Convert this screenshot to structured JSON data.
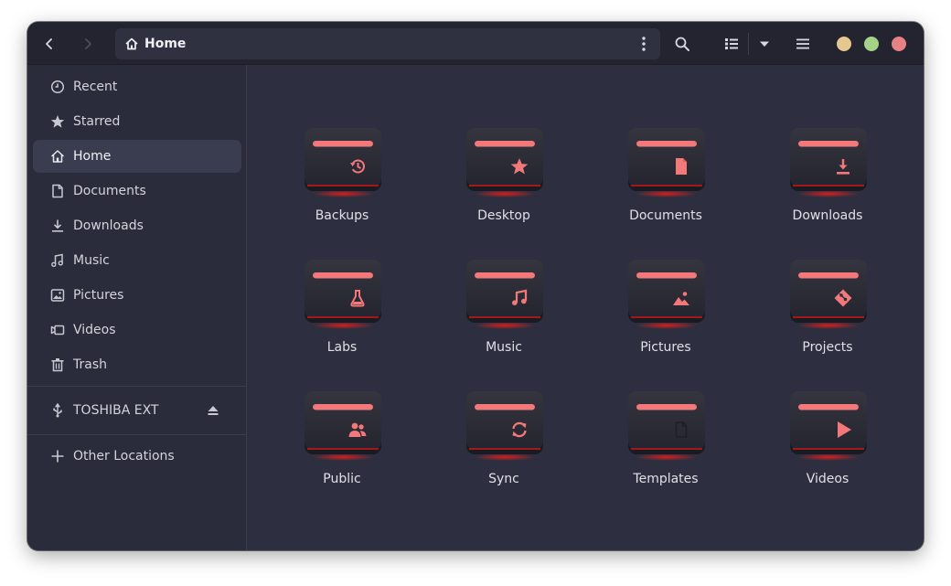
{
  "header": {
    "back_icon": "chevron-left-icon",
    "forward_icon": "chevron-right-icon",
    "path": {
      "icon": "home-icon",
      "label": "Home"
    },
    "path_menu_icon": "vertical-dots-icon",
    "search_icon": "search-icon",
    "view_icon": "list-view-icon",
    "view_dropdown_icon": "caret-down-icon",
    "menu_icon": "hamburger-icon",
    "window_controls": {
      "minimize": "#e5c890",
      "maximize": "#a6d189",
      "close": "#e78284"
    }
  },
  "sidebar": {
    "items": [
      {
        "label": "Recent",
        "icon": "clock-icon"
      },
      {
        "label": "Starred",
        "icon": "star-icon"
      },
      {
        "label": "Home",
        "icon": "home-icon",
        "active": true
      },
      {
        "label": "Documents",
        "icon": "document-icon"
      },
      {
        "label": "Downloads",
        "icon": "download-icon"
      },
      {
        "label": "Music",
        "icon": "music-icon"
      },
      {
        "label": "Pictures",
        "icon": "picture-icon"
      },
      {
        "label": "Videos",
        "icon": "video-camera-icon"
      },
      {
        "label": "Trash",
        "icon": "trash-icon"
      }
    ],
    "devices": [
      {
        "label": "TOSHIBA EXT",
        "icon": "usb-icon",
        "action_icon": "eject-icon"
      }
    ],
    "other": {
      "label": "Other Locations",
      "icon": "plus-icon"
    }
  },
  "folders": [
    {
      "label": "Backups",
      "icon": "history-icon"
    },
    {
      "label": "Desktop",
      "icon": "star-icon"
    },
    {
      "label": "Documents",
      "icon": "document-icon"
    },
    {
      "label": "Downloads",
      "icon": "download-icon"
    },
    {
      "label": "Labs",
      "icon": "flask-icon"
    },
    {
      "label": "Music",
      "icon": "music-icon"
    },
    {
      "label": "Pictures",
      "icon": "picture-icon"
    },
    {
      "label": "Projects",
      "icon": "git-icon"
    },
    {
      "label": "Public",
      "icon": "people-icon"
    },
    {
      "label": "Sync",
      "icon": "sync-icon"
    },
    {
      "label": "Templates",
      "icon": "template-icon"
    },
    {
      "label": "Videos",
      "icon": "play-icon"
    }
  ],
  "colors": {
    "accent": "#f2787a",
    "folder_body": "#2a2b36",
    "folder_glow": "#d81e1e",
    "background": "#2d2f40",
    "sidebar": "#2b2c3b",
    "header": "#23242f"
  }
}
